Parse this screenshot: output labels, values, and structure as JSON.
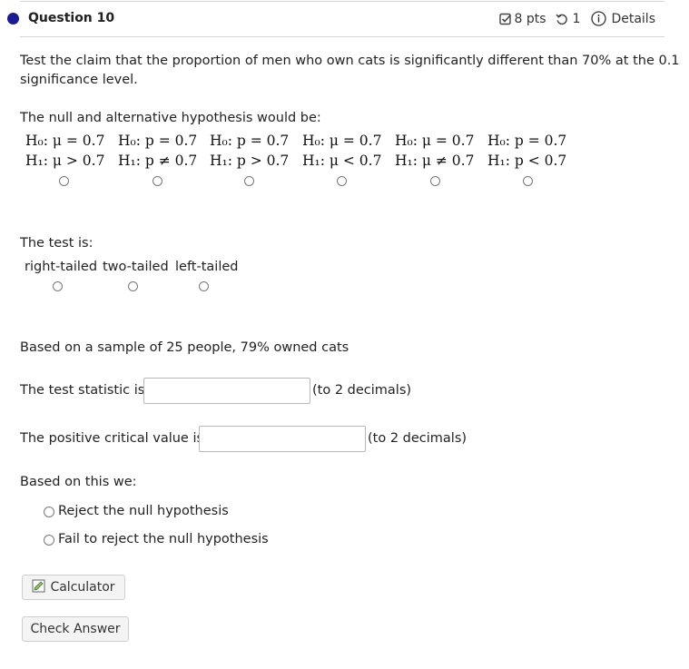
{
  "header": {
    "question_title": "Question 10",
    "points": "8 pts",
    "attempts": "1",
    "details": "Details"
  },
  "prompt": {
    "line1": "Test the claim that the proportion of men who own cats is significantly different than 70% at the 0.1",
    "line2": "significance level."
  },
  "hypothesis": {
    "label": "The null and alternative hypothesis would be:",
    "options": [
      {
        "h0": "H₀: μ = 0.7",
        "h1": "H₁: μ > 0.7"
      },
      {
        "h0": "H₀: p = 0.7",
        "h1": "H₁: p ≠ 0.7"
      },
      {
        "h0": "H₀: p = 0.7",
        "h1": "H₁: p > 0.7"
      },
      {
        "h0": "H₀: μ = 0.7",
        "h1": "H₁: μ < 0.7"
      },
      {
        "h0": "H₀: μ = 0.7",
        "h1": "H₁: μ ≠ 0.7"
      },
      {
        "h0": "H₀: p = 0.7",
        "h1": "H₁: p < 0.7"
      }
    ]
  },
  "test_type": {
    "label": "The test is:",
    "options": [
      "right-tailed",
      "two-tailed",
      "left-tailed"
    ]
  },
  "sample_text": "Based on a sample of 25 people, 79% owned cats",
  "test_statistic": {
    "label": "The test statistic is:",
    "value": "",
    "hint": "(to 2 decimals)"
  },
  "critical_value": {
    "label": "The positive critical value is:",
    "value": "",
    "hint": "(to 2 decimals)"
  },
  "decision": {
    "label": "Based on this we:",
    "options": [
      "Reject the null hypothesis",
      "Fail to reject the null hypothesis"
    ]
  },
  "buttons": {
    "calculator": "Calculator",
    "check_answer": "Check Answer"
  },
  "colors": {
    "question_dot": "#1b1b8f",
    "border": "#d4d4d4"
  }
}
